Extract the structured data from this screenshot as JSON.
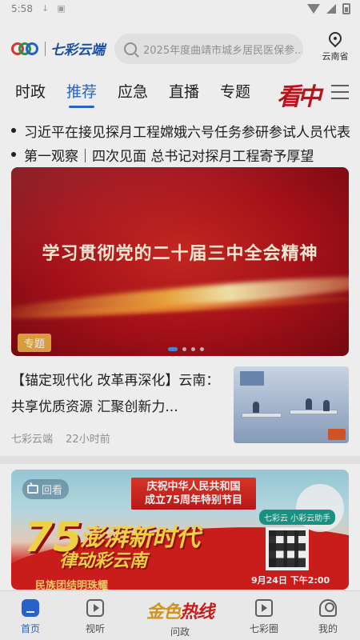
{
  "status_bar": {
    "time": "5:58"
  },
  "header": {
    "logo_text": "七彩云端",
    "search_placeholder": "2025年度曲靖市城乡居民医保参...",
    "location_label": "云南省"
  },
  "tabs": [
    {
      "label": "时政"
    },
    {
      "label": "推荐",
      "active": true
    },
    {
      "label": "应急"
    },
    {
      "label": "直播"
    },
    {
      "label": "专题"
    }
  ],
  "tabs_brand": "看中",
  "headlines": [
    "习近平在接见探月工程嫦娥六号任务参研参试人员代表",
    "第一观察｜四次见面 总书记对探月工程寄予厚望"
  ],
  "banner": {
    "title": "学习贯彻党的二十届三中全会精神",
    "badge": "专题",
    "slide_count": 4,
    "active_slide": 1
  },
  "article": {
    "title": "【锚定现代化 改革再深化】云南：共享优质资源 汇聚创新力...",
    "source": "七彩云端",
    "time": "22小时前"
  },
  "replay_banner": {
    "tag": "回看",
    "heading_line1": "庆祝中华人民共和国",
    "heading_line2": "成立75周年特别节目",
    "number": "75",
    "slogan_line1": "澎湃新时代",
    "slogan_line2": "律动彩云南",
    "helper_label": "七彩云 小彩云助手",
    "date": "9月24日 下午2:00",
    "footer": "民族团结明珠耀"
  },
  "bottom_nav": [
    {
      "label": "首页",
      "icon": "home-icon",
      "active": true
    },
    {
      "label": "视听",
      "icon": "video-icon"
    },
    {
      "label": "问政",
      "icon": "gold-hotline-logo",
      "logo_text_1": "金色",
      "logo_text_2": "热线"
    },
    {
      "label": "七彩圈",
      "icon": "tv-icon"
    },
    {
      "label": "我的",
      "icon": "profile-icon"
    }
  ],
  "colors": {
    "accent": "#2b6bd6",
    "brand_red": "#c8161d",
    "banner_badge": "#e9a844"
  }
}
